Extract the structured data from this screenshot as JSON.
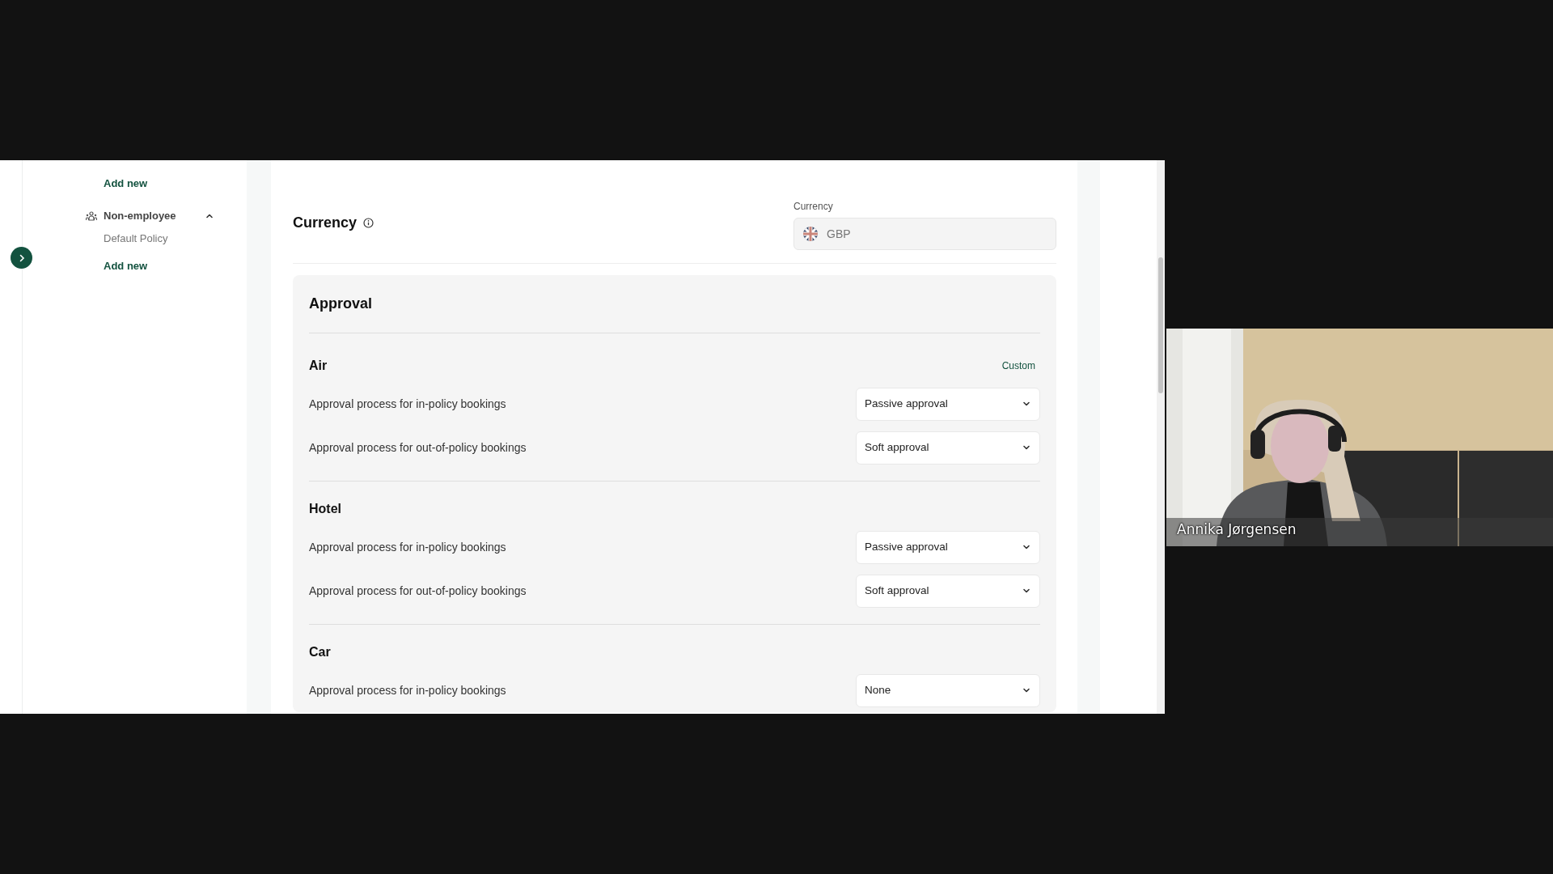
{
  "sidebar": {
    "items": [
      {
        "kind": "link",
        "label": "Add new"
      },
      {
        "kind": "group",
        "label": "Non-employee",
        "expanded": true
      },
      {
        "kind": "item",
        "label": "Default Policy"
      },
      {
        "kind": "link",
        "label": "Add new"
      }
    ]
  },
  "currency": {
    "title": "Currency",
    "field_label": "Currency",
    "value": "GBP",
    "disabled": true
  },
  "approval": {
    "title": "Approval",
    "sections": [
      {
        "title": "Air",
        "badge": "Custom",
        "rows": [
          {
            "label": "Approval process for in-policy bookings",
            "value": "Passive approval"
          },
          {
            "label": "Approval process for out-of-policy bookings",
            "value": "Soft approval"
          }
        ]
      },
      {
        "title": "Hotel",
        "rows": [
          {
            "label": "Approval process for in-policy bookings",
            "value": "Passive approval"
          },
          {
            "label": "Approval process for out-of-policy bookings",
            "value": "Soft approval"
          }
        ]
      },
      {
        "title": "Car",
        "rows": [
          {
            "label": "Approval process for in-policy bookings",
            "value": "None"
          }
        ]
      }
    ]
  },
  "video": {
    "kind": "picture",
    "name": "Annika Jørgensen"
  }
}
